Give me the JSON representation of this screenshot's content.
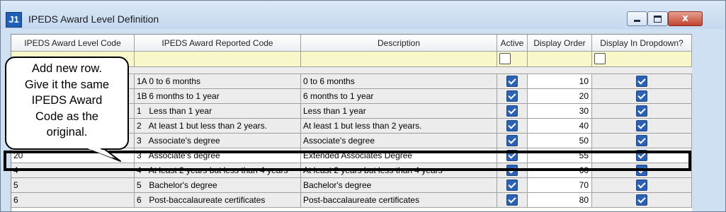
{
  "window": {
    "title": "IPEDS Award Level Definition",
    "app_icon": "J1",
    "close_symbol": "x"
  },
  "columns": [
    "IPEDS Award Level Code",
    "IPEDS Award Reported Code",
    "Description",
    "Active",
    "Display Order",
    "Display In Dropdown?"
  ],
  "rows": [
    {
      "level_code": "",
      "reported_code": "1A",
      "reported_text": "0 to 6 months",
      "description": "0 to 6 months",
      "active": true,
      "order": "10",
      "dropdown": true
    },
    {
      "level_code": "",
      "reported_code": "1B",
      "reported_text": "6 months to 1 year",
      "description": "6 months to 1 year",
      "active": true,
      "order": "20",
      "dropdown": true
    },
    {
      "level_code": "",
      "reported_code": "1",
      "reported_text": "Less than 1 year",
      "description": "Less than 1 year",
      "active": true,
      "order": "30",
      "dropdown": true
    },
    {
      "level_code": "",
      "reported_code": "2",
      "reported_text": "At least 1 but less than 2 years.",
      "description": "At least 1 but less than 2 years.",
      "active": true,
      "order": "40",
      "dropdown": true
    },
    {
      "level_code": "",
      "reported_code": "3",
      "reported_text": "Associate's degree",
      "description": "Associate's degree",
      "active": true,
      "order": "50",
      "dropdown": true
    },
    {
      "level_code": "20",
      "reported_code": "3",
      "reported_text": "Associate's degree",
      "description": "Extended Associates Degree",
      "active": true,
      "order": "55",
      "dropdown": true
    },
    {
      "level_code": "4",
      "reported_code": "4",
      "reported_text": "At least 2 years but less than 4 years",
      "description": "At least 2 years but less than 4 years",
      "active": true,
      "order": "60",
      "dropdown": true
    },
    {
      "level_code": "5",
      "reported_code": "5",
      "reported_text": "Bachelor's degree",
      "description": "Bachelor's degree",
      "active": true,
      "order": "70",
      "dropdown": true
    },
    {
      "level_code": "6",
      "reported_code": "6",
      "reported_text": "Post-baccalaureate certificates",
      "description": "Post-baccalaureate certificates",
      "active": true,
      "order": "80",
      "dropdown": true
    }
  ],
  "callout": {
    "lines": [
      "Add new row.",
      "Give it the same",
      "IPEDS Award",
      "Code as the",
      "original."
    ]
  }
}
